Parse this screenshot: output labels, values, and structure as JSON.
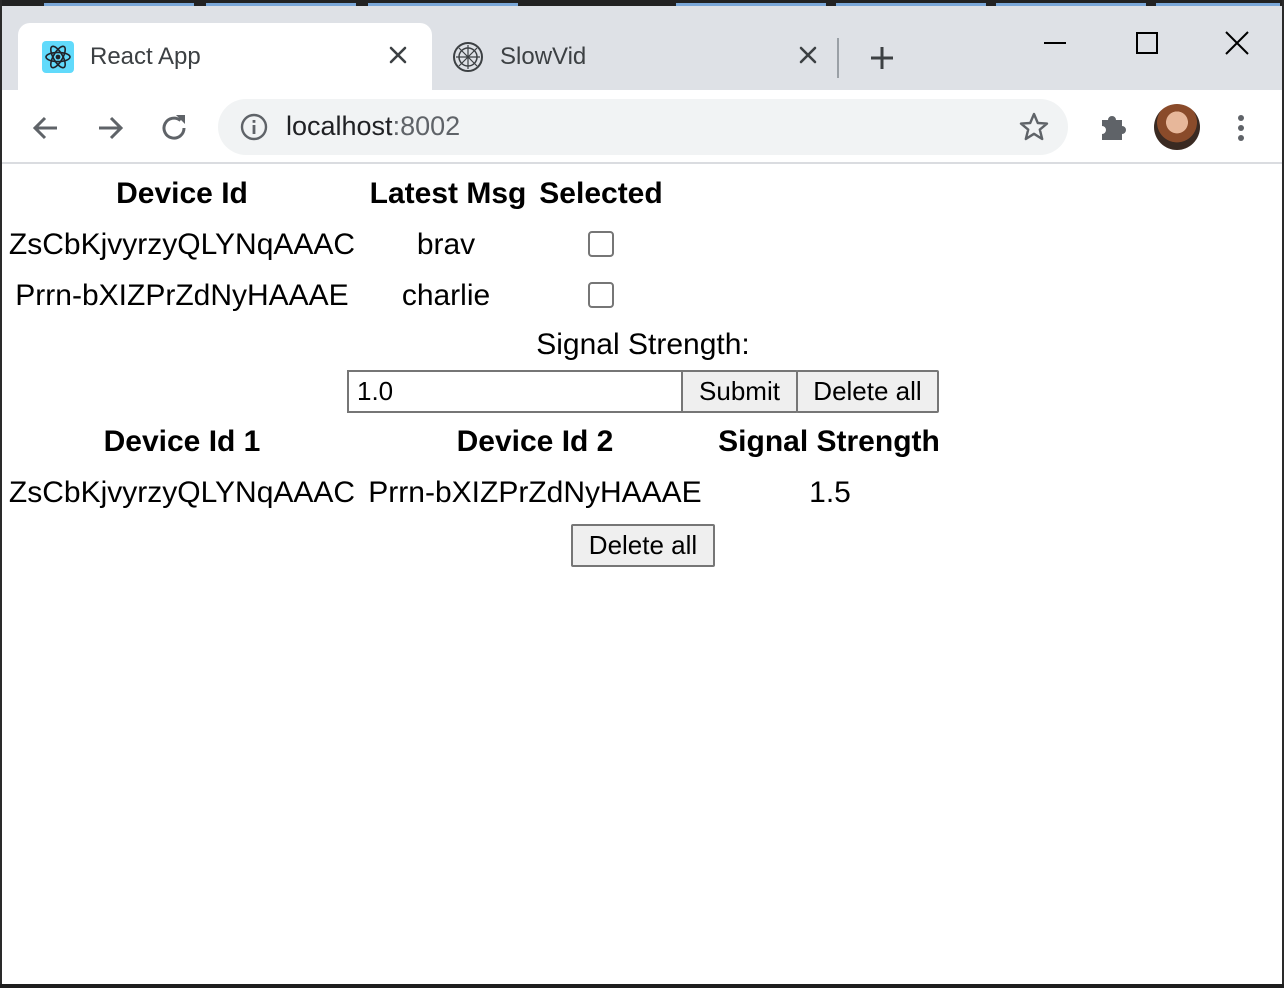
{
  "browser": {
    "tabs": [
      {
        "title": "React App",
        "favicon": "react-icon",
        "active": true
      },
      {
        "title": "SlowVid",
        "favicon": "slowvid-icon",
        "active": false
      }
    ],
    "address": {
      "host": "localhost",
      "port": ":8002"
    }
  },
  "devices_table": {
    "headers": [
      "Device Id",
      "Latest Msg",
      "Selected"
    ],
    "rows": [
      {
        "device_id": "ZsCbKjvyrzyQLYNqAAAC",
        "latest_msg": "brav",
        "selected": false
      },
      {
        "device_id": "Prrn-bXIZPrZdNyHAAAE",
        "latest_msg": "charlie",
        "selected": false
      }
    ]
  },
  "signal_form": {
    "label": "Signal Strength:",
    "value": "1.0",
    "submit_label": "Submit",
    "delete_label": "Delete all"
  },
  "pairs_table": {
    "headers": [
      "Device Id 1",
      "Device Id 2",
      "Signal Strength"
    ],
    "rows": [
      {
        "device_id_1": "ZsCbKjvyrzyQLYNqAAAC",
        "device_id_2": "Prrn-bXIZPrZdNyHAAAE",
        "signal_strength": "1.5"
      }
    ],
    "delete_label": "Delete all"
  },
  "colors": {
    "tabbar": "#dee1e6",
    "omnibox": "#f1f3f4",
    "react": "#61dafb",
    "button": "#efefef"
  }
}
